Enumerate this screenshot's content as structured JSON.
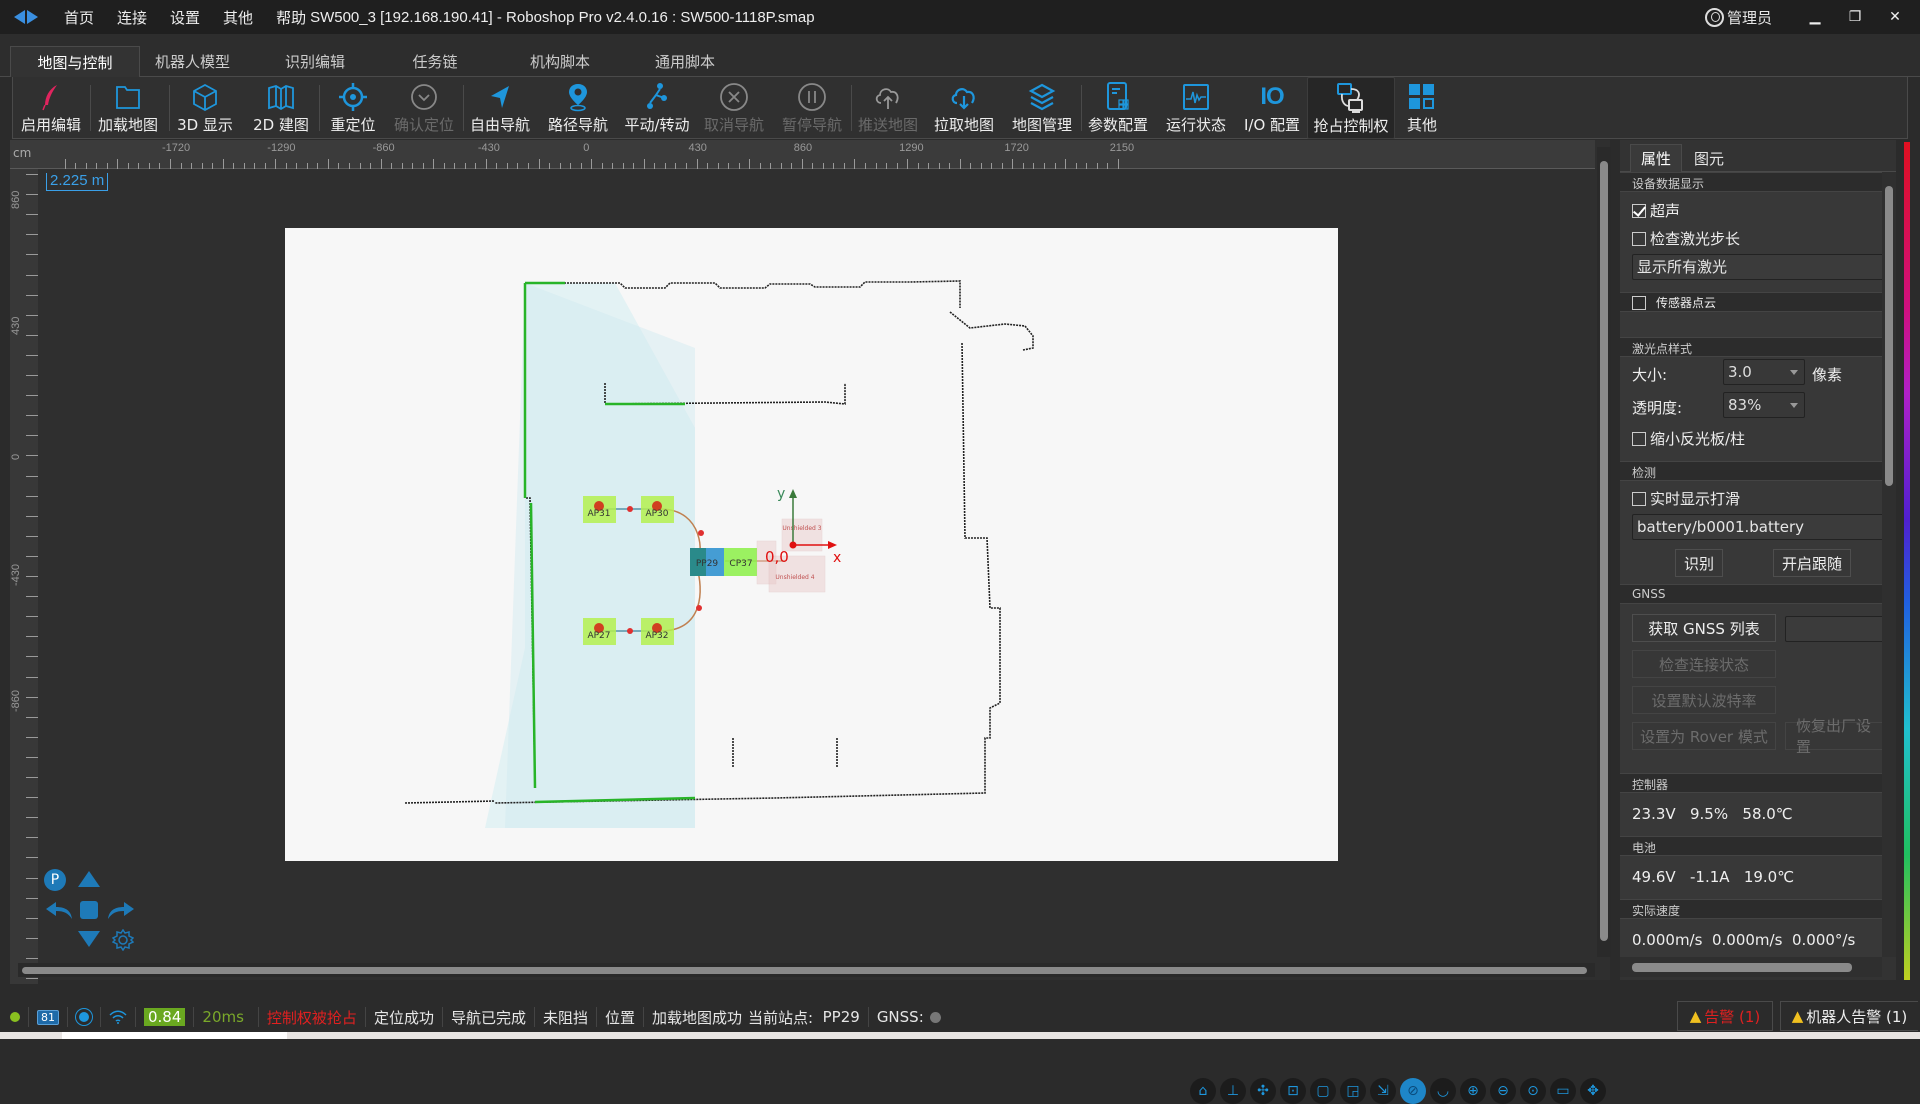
{
  "titlebar": {
    "menus": [
      "首页",
      "连接",
      "设置",
      "其他",
      "帮助"
    ],
    "title": "SW500_3 [192.168.190.41] - Roboshop Pro v2.4.0.16 : SW500-1118P.smap",
    "user": "管理员",
    "minimize": "▁",
    "restore": "❐",
    "close": "✕"
  },
  "tabs": [
    "地图与控制",
    "机器人模型",
    "识别编辑",
    "任务链",
    "机构脚本",
    "通用脚本"
  ],
  "toolbar": [
    {
      "label": "启用编辑",
      "icon": "feather-pen-icon",
      "enabled": true
    },
    {
      "label": "加载地图",
      "icon": "folder-icon",
      "enabled": true
    },
    {
      "label": "3D 显示",
      "icon": "cube-icon",
      "enabled": true
    },
    {
      "label": "2D 建图",
      "icon": "map-fold-icon",
      "enabled": true
    },
    {
      "label": "重定位",
      "icon": "crosshair-icon",
      "enabled": true
    },
    {
      "label": "确认定位",
      "icon": "check-circle-icon",
      "enabled": false
    },
    {
      "label": "自由导航",
      "icon": "navigation-arrow-icon",
      "enabled": true
    },
    {
      "label": "路径导航",
      "icon": "location-pin-icon",
      "enabled": true
    },
    {
      "label": "平动/转动",
      "icon": "route-nodes-icon",
      "enabled": true
    },
    {
      "label": "取消导航",
      "icon": "cancel-circle-icon",
      "enabled": false
    },
    {
      "label": "暂停导航",
      "icon": "pause-circle-icon",
      "enabled": false
    },
    {
      "label": "推送地图",
      "icon": "cloud-upload-icon",
      "enabled": false
    },
    {
      "label": "拉取地图",
      "icon": "cloud-download-icon",
      "enabled": true
    },
    {
      "label": "地图管理",
      "icon": "layers-icon",
      "enabled": true
    },
    {
      "label": "参数配置",
      "icon": "document-grid-icon",
      "enabled": true
    },
    {
      "label": "运行状态",
      "icon": "waveform-monitor-icon",
      "enabled": true
    },
    {
      "label": "I/O 配置",
      "icon": "io-icon",
      "enabled": true
    },
    {
      "label": "抢占控制权",
      "icon": "control-takeover-icon",
      "enabled": true,
      "selected": true
    },
    {
      "label": "其他",
      "icon": "grid-tiles-icon",
      "enabled": true
    }
  ],
  "map": {
    "ruler_unit": "cm",
    "h_ticks": [
      "-1720",
      "-1290",
      "-860",
      "-430",
      "0",
      "430",
      "860",
      "1290",
      "1720",
      "2150"
    ],
    "v_ticks": [
      "860",
      "430",
      "0",
      "-430",
      "-860"
    ],
    "scale_label": "2.225 m",
    "stations": [
      {
        "id": "AP31"
      },
      {
        "id": "AP30"
      },
      {
        "id": "AP27"
      },
      {
        "id": "AP32"
      },
      {
        "id": "PP29"
      },
      {
        "id": "CP37"
      }
    ],
    "origin_label": "0,0",
    "axis_x": "x",
    "axis_y": "y",
    "regions": [
      "Unshielded 3",
      "Unshielded 4"
    ],
    "pad": {
      "p_label": "P"
    }
  },
  "map_tools": [
    "tag-icon",
    "axes-3d-icon",
    "fit-center-icon",
    "zoom-area-icon",
    "fit-window-icon",
    "cast-icon",
    "export-icon",
    "laser-toggle-icon",
    "eye-closed-icon",
    "zoom-in-icon",
    "zoom-out-icon",
    "zoom-reset-icon",
    "ruler-icon",
    "move-icon"
  ],
  "panel": {
    "tabs": [
      "属性",
      "图元"
    ],
    "device_display": {
      "title": "设备数据显示",
      "ultrasonic": {
        "label": "超声",
        "checked": true
      },
      "laser_step": {
        "label": "检查激光步长",
        "checked": false
      },
      "laser_select": "显示所有激光"
    },
    "sensor_cloud": {
      "label": "传感器点云",
      "checked": false
    },
    "laser_style": {
      "title": "激光点样式",
      "size_label": "大小:",
      "size_value": "3.0",
      "size_unit": "像素",
      "opacity_label": "透明度:",
      "opacity_value": "83%",
      "shrink_reflector": {
        "label": "缩小反光板/柱",
        "checked": false
      }
    },
    "detect": {
      "title": "检测",
      "realtime_slip": {
        "label": "实时显示打滑",
        "checked": false
      },
      "file": "battery/b0001.battery",
      "recognize_btn": "识别",
      "follow_btn": "开启跟随"
    },
    "gnss": {
      "title": "GNSS",
      "get_list_btn": "获取 GNSS 列表",
      "check_conn_btn": "检查连接状态",
      "set_baud_btn": "设置默认波特率",
      "rover_btn": "设置为 Rover 模式",
      "factory_btn": "恢复出厂设置",
      "list_value": ""
    },
    "controller": {
      "title": "控制器",
      "voltage": "23.3V",
      "percent": "9.5%",
      "temp": "58.0℃"
    },
    "battery": {
      "title": "电池",
      "voltage": "49.6V",
      "current": "-1.1A",
      "temp": "19.0℃"
    },
    "speed": {
      "title": "实际速度",
      "vx": "0.000m/s",
      "vy": "0.000m/s",
      "w": "0.000°/s"
    }
  },
  "status": {
    "battery_level": "81",
    "signal_value": "0.84",
    "latency": "20ms",
    "control_status": "控制权被抢占",
    "localization": "定位成功",
    "navigation": "导航已完成",
    "blocked": "未阻挡",
    "position": "位置",
    "map_loaded": "加载地图成功",
    "current_station_label": "当前站点:",
    "current_station": "PP29",
    "gnss_label": "GNSS:",
    "alarm": "告警 (1)",
    "robot_alarm": "机器人告警 (1)"
  },
  "colors": {
    "accent": "#1e96dc",
    "alarm_red": "#e02020",
    "ok_green": "#7aa82a",
    "station_green": "#b4f050"
  }
}
